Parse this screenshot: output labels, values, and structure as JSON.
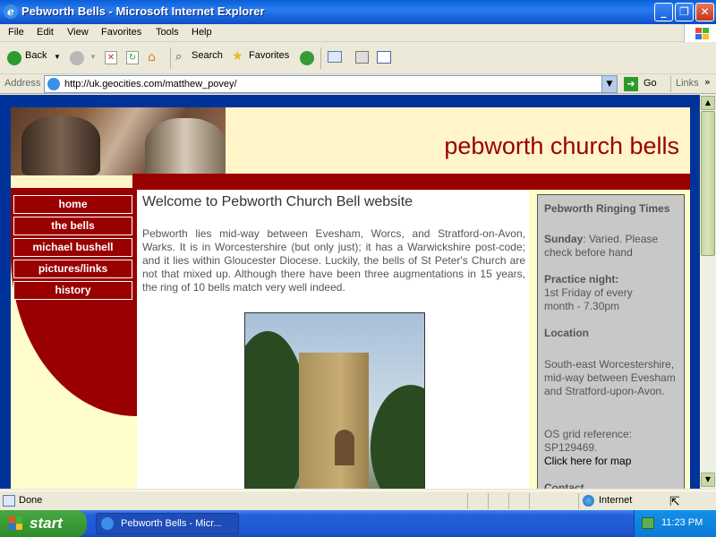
{
  "window": {
    "title": "Pebworth Bells - Microsoft Internet Explorer"
  },
  "menu": {
    "items": [
      "File",
      "Edit",
      "View",
      "Favorites",
      "Tools",
      "Help"
    ]
  },
  "toolbar": {
    "back": "Back",
    "search": "Search",
    "favorites": "Favorites"
  },
  "address": {
    "label": "Address",
    "url": "http://uk.geocities.com/matthew_povey/",
    "go": "Go",
    "links": "Links"
  },
  "site": {
    "title": "pebworth church bells",
    "nav": [
      "home",
      "the bells",
      "michael bushell",
      "pictures/links",
      "history"
    ],
    "heading": "Welcome to Pebworth Church Bell website",
    "intro": "Pebworth lies mid-way between Evesham, Worcs, and Stratford-on-Avon, Warks. It is in Worcestershire (but only just); it has a Warwickshire post-code; and it lies within Gloucester Diocese. Luckily, the bells of St Peter's Church are not that mixed up. Although there have been three augmentations in 15 years, the ring of 10 bells match very well indeed.",
    "sidebar": {
      "title": "Pebworth Ringing Times",
      "sunday_label": "Sunday",
      "sunday_text": ": Varied. Please check before hand",
      "practice_label": "Practice night:",
      "practice_text": "1st Friday of every month - 7.30pm",
      "location_label": "Location",
      "location_text": "South-east Worcestershire, mid-way between Evesham and Stratford-upon-Avon.",
      "grid_ref": "OS grid reference: SP129469.",
      "map_link": "Click here for map",
      "more": "Contact"
    }
  },
  "status": {
    "text": "Done",
    "zone": "Internet"
  },
  "taskbar": {
    "start": "start",
    "item": "Pebworth Bells - Micr...",
    "time": "11:23 PM"
  }
}
